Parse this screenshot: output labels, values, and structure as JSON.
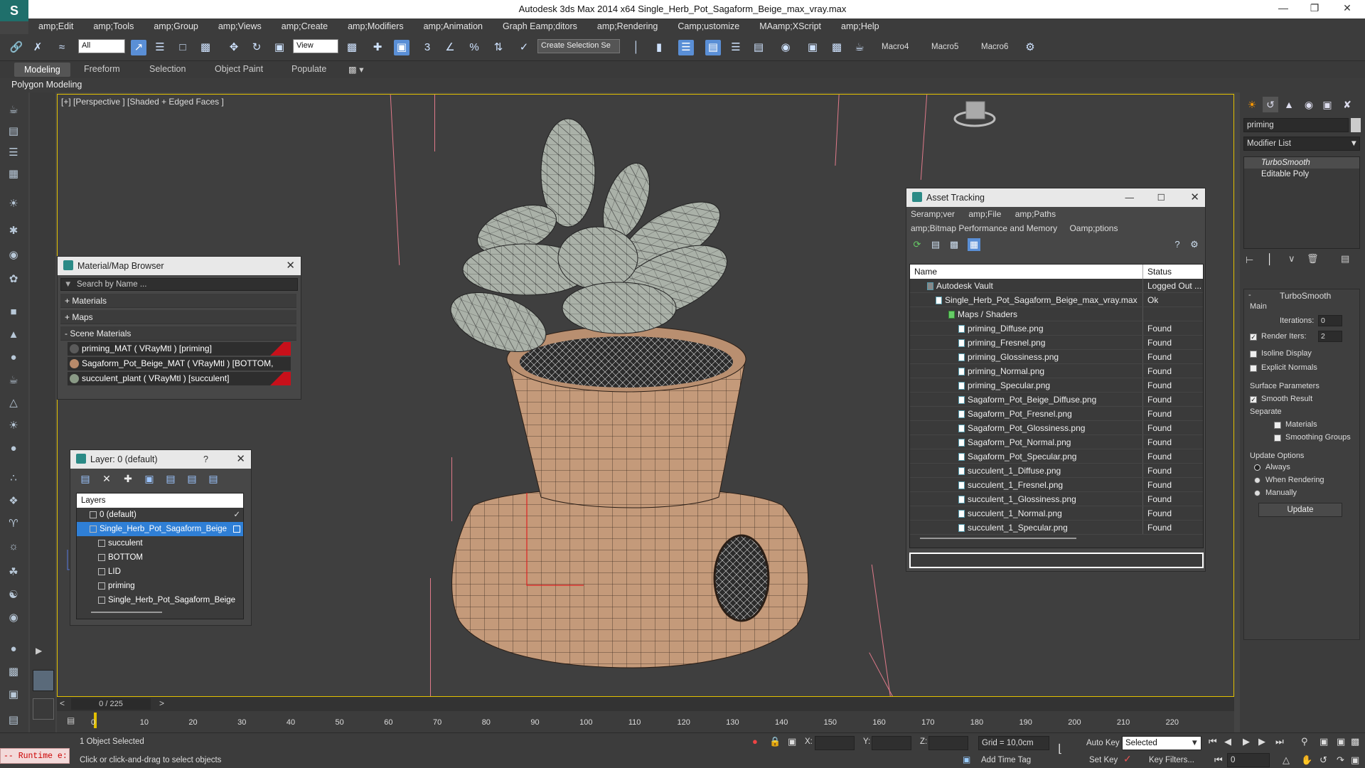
{
  "window": {
    "app_title": "Autodesk 3ds Max  2014 x64    Single_Herb_Pot_Sagaform_Beige_max_vray.max",
    "min_icon": "minimize-icon",
    "max_icon": "maximize-icon",
    "close_icon": "close-icon"
  },
  "menu": [
    "amp;Edit",
    "amp;Tools",
    "amp;Group",
    "amp;Views",
    "amp;Create",
    "amp;Modifiers",
    "amp;Animation",
    "Graph Eamp;ditors",
    "amp;Rendering",
    "Camp;ustomize",
    "MAamp;XScript",
    "amp;Help"
  ],
  "toolbar": {
    "filter_value": "All",
    "refcoord_value": "View",
    "selection_set_placeholder": "Create Selection Se",
    "macros": [
      "Macro4",
      "Macro5",
      "Macro6"
    ]
  },
  "ribbon": {
    "tabs": [
      "Modeling",
      "Freeform",
      "Selection",
      "Object Paint",
      "Populate"
    ],
    "active_tab": "Modeling",
    "subpanel": "Polygon Modeling"
  },
  "viewport": {
    "label": "[+] [Perspective ] [Shaded + Edged Faces ]"
  },
  "material_browser": {
    "title": "Material/Map Browser",
    "search_placeholder": "Search by Name ...",
    "groups": [
      "+ Materials",
      "+ Maps",
      "- Scene Materials"
    ],
    "materials": [
      {
        "label": "priming_MAT  ( VRayMtl )  [priming]",
        "color": "#5a5a5a"
      },
      {
        "label": "Sagaform_Pot_Beige_MAT  ( VRayMtl )  [BOTTOM, LID]",
        "color": "#b88a6a"
      },
      {
        "label": "succulent_plant  ( VRayMtl )  [succulent]",
        "color": "#8a9a86"
      }
    ]
  },
  "layer_panel": {
    "title": "Layer: 0 (default)",
    "help": "?",
    "header": "Layers",
    "rows": [
      {
        "label": "0 (default)",
        "indent": 1,
        "selected": false
      },
      {
        "label": "Single_Herb_Pot_Sagaform_Beige",
        "indent": 1,
        "selected": true
      },
      {
        "label": "succulent",
        "indent": 2,
        "selected": false
      },
      {
        "label": "BOTTOM",
        "indent": 2,
        "selected": false
      },
      {
        "label": "LID",
        "indent": 2,
        "selected": false
      },
      {
        "label": "priming",
        "indent": 2,
        "selected": false
      },
      {
        "label": "Single_Herb_Pot_Sagaform_Beige",
        "indent": 2,
        "selected": false
      }
    ]
  },
  "asset_tracking": {
    "title": "Asset Tracking",
    "menu_row1": [
      "Seramp;ver",
      "amp;File",
      "amp;Paths"
    ],
    "menu_row2": [
      "amp;Bitmap Performance and Memory",
      "Oamp;ptions"
    ],
    "col_name": "Name",
    "col_status": "Status",
    "rows": [
      {
        "name": "Autodesk Vault",
        "status": "Logged Out ...",
        "indent": 1
      },
      {
        "name": "Single_Herb_Pot_Sagaform_Beige_max_vray.max",
        "status": "Ok",
        "indent": 2
      },
      {
        "name": "Maps / Shaders",
        "status": "",
        "indent": 3
      },
      {
        "name": "priming_Diffuse.png",
        "status": "Found",
        "indent": 4
      },
      {
        "name": "priming_Fresnel.png",
        "status": "Found",
        "indent": 4
      },
      {
        "name": "priming_Glossiness.png",
        "status": "Found",
        "indent": 4
      },
      {
        "name": "priming_Normal.png",
        "status": "Found",
        "indent": 4
      },
      {
        "name": "priming_Specular.png",
        "status": "Found",
        "indent": 4
      },
      {
        "name": "Sagaform_Pot_Beige_Diffuse.png",
        "status": "Found",
        "indent": 4
      },
      {
        "name": "Sagaform_Pot_Fresnel.png",
        "status": "Found",
        "indent": 4
      },
      {
        "name": "Sagaform_Pot_Glossiness.png",
        "status": "Found",
        "indent": 4
      },
      {
        "name": "Sagaform_Pot_Normal.png",
        "status": "Found",
        "indent": 4
      },
      {
        "name": "Sagaform_Pot_Specular.png",
        "status": "Found",
        "indent": 4
      },
      {
        "name": "succulent_1_Diffuse.png",
        "status": "Found",
        "indent": 4
      },
      {
        "name": "succulent_1_Fresnel.png",
        "status": "Found",
        "indent": 4
      },
      {
        "name": "succulent_1_Glossiness.png",
        "status": "Found",
        "indent": 4
      },
      {
        "name": "succulent_1_Normal.png",
        "status": "Found",
        "indent": 4
      },
      {
        "name": "succulent_1_Specular.png",
        "status": "Found",
        "indent": 4
      }
    ]
  },
  "command_panel": {
    "object_name": "priming",
    "modifier_list": "Modifier List",
    "stack": [
      "TurboSmooth",
      "Editable Poly"
    ],
    "turbosmooth": {
      "title": "TurboSmooth",
      "main": "Main",
      "iterations_label": "Iterations:",
      "iterations": "0",
      "render_iters_label": "Render Iters:",
      "render_iters": "2",
      "isoline": "Isoline Display",
      "explicit": "Explicit Normals",
      "surface_params": "Surface Parameters",
      "smooth_result": "Smooth Result",
      "separate": "Separate",
      "materials": "Materials",
      "smoothing_groups": "Smoothing Groups",
      "update_options": "Update Options",
      "always": "Always",
      "when_rendering": "When Rendering",
      "manually": "Manually",
      "update_btn": "Update"
    }
  },
  "timeline": {
    "frame": "0 / 225",
    "ticks": [
      "0",
      "10",
      "20",
      "30",
      "40",
      "50",
      "60",
      "70",
      "80",
      "90",
      "100",
      "110",
      "120",
      "130",
      "140",
      "150",
      "160",
      "170",
      "180",
      "190",
      "200",
      "210",
      "220"
    ]
  },
  "status": {
    "runtime": "-- Runtime e:",
    "selected": "1 Object Selected",
    "prompt": "Click or click-and-drag to select objects",
    "x_label": "X:",
    "y_label": "Y:",
    "z_label": "Z:",
    "grid": "Grid = 10,0cm",
    "add_time_tag": "Add Time Tag",
    "auto_key": "Auto Key",
    "set_key": "Set Key",
    "selected_value": "Selected",
    "key_filters": "Key Filters...",
    "frame_field": "0"
  }
}
